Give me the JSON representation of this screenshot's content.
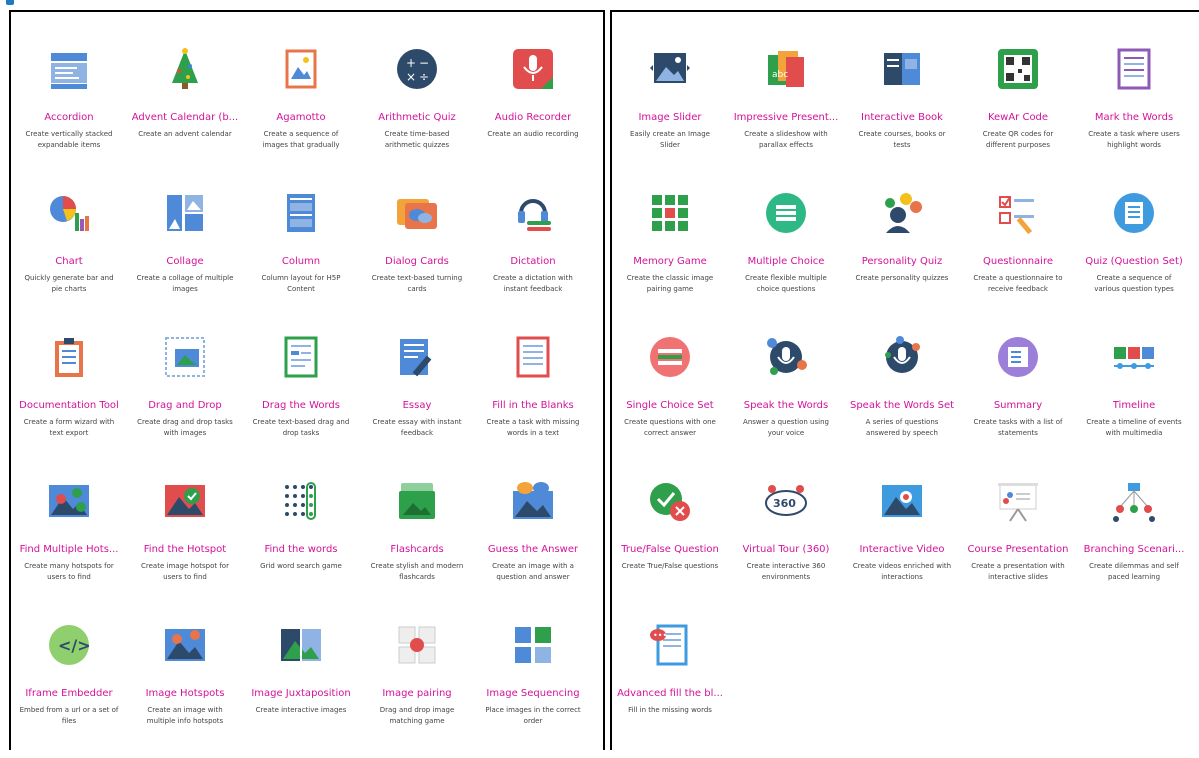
{
  "left_tiles": [
    {
      "name": "Accordion",
      "desc": "Create vertically stacked expandable items",
      "icon": "accordion-icon"
    },
    {
      "name": "Advent Calendar (b...",
      "desc": "Create an advent calendar",
      "icon": "advent-calendar-icon"
    },
    {
      "name": "Agamotto",
      "desc": "Create a sequence of images that gradually",
      "icon": "agamotto-icon"
    },
    {
      "name": "Arithmetic Quiz",
      "desc": "Create time-based arithmetic quizzes",
      "icon": "arithmetic-quiz-icon"
    },
    {
      "name": "Audio Recorder",
      "desc": "Create an audio recording",
      "icon": "audio-recorder-icon"
    },
    {
      "name": "Chart",
      "desc": "Quickly generate bar and pie charts",
      "icon": "chart-icon"
    },
    {
      "name": "Collage",
      "desc": "Create a collage of multiple images",
      "icon": "collage-icon"
    },
    {
      "name": "Column",
      "desc": "Column layout for H5P Content",
      "icon": "column-icon"
    },
    {
      "name": "Dialog Cards",
      "desc": "Create text-based turning cards",
      "icon": "dialog-cards-icon"
    },
    {
      "name": "Dictation",
      "desc": "Create a dictation with instant feedback",
      "icon": "dictation-icon"
    },
    {
      "name": "Documentation Tool",
      "desc": "Create a form wizard with text export",
      "icon": "documentation-tool-icon"
    },
    {
      "name": "Drag and Drop",
      "desc": "Create drag and drop tasks with images",
      "icon": "drag-and-drop-icon"
    },
    {
      "name": "Drag the Words",
      "desc": "Create text-based drag and drop tasks",
      "icon": "drag-the-words-icon"
    },
    {
      "name": "Essay",
      "desc": "Create essay with instant feedback",
      "icon": "essay-icon"
    },
    {
      "name": "Fill in the Blanks",
      "desc": "Create a task with missing words in a text",
      "icon": "fill-in-the-blanks-icon"
    },
    {
      "name": "Find Multiple Hots...",
      "desc": "Create many hotspots for users to find",
      "icon": "find-multiple-hotspots-icon"
    },
    {
      "name": "Find the Hotspot",
      "desc": "Create image hotspot for users to find",
      "icon": "find-the-hotspot-icon"
    },
    {
      "name": "Find the words",
      "desc": "Grid word search game",
      "icon": "find-the-words-icon"
    },
    {
      "name": "Flashcards",
      "desc": "Create stylish and modern flashcards",
      "icon": "flashcards-icon"
    },
    {
      "name": "Guess the Answer",
      "desc": "Create an image with a question and answer",
      "icon": "guess-the-answer-icon"
    },
    {
      "name": "Iframe Embedder",
      "desc": "Embed from a url or a set of files",
      "icon": "iframe-embedder-icon"
    },
    {
      "name": "Image Hotspots",
      "desc": "Create an image with multiple info hotspots",
      "icon": "image-hotspots-icon"
    },
    {
      "name": "Image Juxtaposition",
      "desc": "Create interactive images",
      "icon": "image-juxtaposition-icon"
    },
    {
      "name": "Image pairing",
      "desc": "Drag and drop image matching game",
      "icon": "image-pairing-icon"
    },
    {
      "name": "Image Sequencing",
      "desc": "Place images in the correct order",
      "icon": "image-sequencing-icon"
    }
  ],
  "right_tiles": [
    {
      "name": "Image Slider",
      "desc": "Easily create an Image Slider",
      "icon": "image-slider-icon"
    },
    {
      "name": "Impressive Present...",
      "desc": "Create a slideshow with parallax effects",
      "icon": "impressive-presentation-icon"
    },
    {
      "name": "Interactive Book",
      "desc": "Create courses, books or tests",
      "icon": "interactive-book-icon"
    },
    {
      "name": "KewAr Code",
      "desc": "Create QR codes for different purposes",
      "icon": "qr-code-icon"
    },
    {
      "name": "Mark the Words",
      "desc": "Create a task where users highlight words",
      "icon": "mark-the-words-icon"
    },
    {
      "name": "Memory Game",
      "desc": "Create the classic image pairing game",
      "icon": "memory-game-icon"
    },
    {
      "name": "Multiple Choice",
      "desc": "Create flexible multiple choice questions",
      "icon": "multiple-choice-icon"
    },
    {
      "name": "Personality Quiz",
      "desc": "Create personality quizzes",
      "icon": "personality-quiz-icon"
    },
    {
      "name": "Questionnaire",
      "desc": "Create a questionnaire to receive feedback",
      "icon": "questionnaire-icon"
    },
    {
      "name": "Quiz (Question Set)",
      "desc": "Create a sequence of various question types",
      "icon": "quiz-question-set-icon"
    },
    {
      "name": "Single Choice Set",
      "desc": "Create questions with one correct answer",
      "icon": "single-choice-set-icon"
    },
    {
      "name": "Speak the Words",
      "desc": "Answer a question using your voice",
      "icon": "speak-the-words-icon"
    },
    {
      "name": "Speak the Words Set",
      "desc": "A series of questions answered by speech",
      "icon": "speak-the-words-set-icon"
    },
    {
      "name": "Summary",
      "desc": "Create tasks with a list of statements",
      "icon": "summary-icon"
    },
    {
      "name": "Timeline",
      "desc": "Create a timeline of events with multimedia",
      "icon": "timeline-icon"
    },
    {
      "name": "True/False Question",
      "desc": "Create True/False questions",
      "icon": "true-false-question-icon"
    },
    {
      "name": "Virtual Tour (360)",
      "desc": "Create interactive 360 environments",
      "icon": "virtual-tour-360-icon"
    },
    {
      "name": "Interactive Video",
      "desc": "Create videos enriched with interactions",
      "icon": "interactive-video-icon"
    },
    {
      "name": "Course Presentation",
      "desc": "Create a presentation with interactive slides",
      "icon": "course-presentation-icon"
    },
    {
      "name": "Branching Scenari...",
      "desc": "Create dilemmas and self paced learning",
      "icon": "branching-scenario-icon"
    },
    {
      "name": "Advanced fill the bl...",
      "desc": "Fill in the missing words",
      "icon": "advanced-fill-the-blanks-icon"
    }
  ],
  "colors": {
    "title": "#d4119a",
    "desc": "#444444",
    "border": "#000000"
  }
}
